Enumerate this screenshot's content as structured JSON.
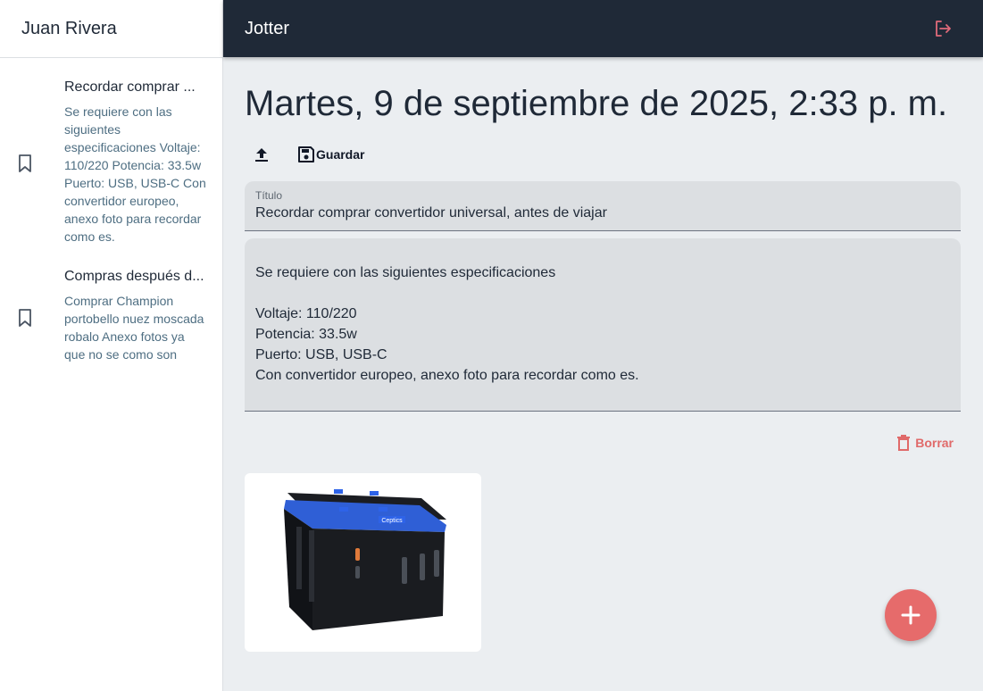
{
  "user": {
    "name": "Juan Rivera"
  },
  "app": {
    "title": "Jotter"
  },
  "notes": [
    {
      "title": "Recordar comprar ...",
      "preview": "Se requiere con las siguientes especificaciones Voltaje: 110/220 Potencia: 33.5w Puerto: USB, USB-C Con convertidor europeo, anexo foto para recordar como es."
    },
    {
      "title": "Compras después d...",
      "preview": "Comprar Champion portobello nuez moscada robalo Anexo fotos ya que no se como son"
    }
  ],
  "editor": {
    "date": "Martes, 9 de septiembre de 2025, 2:33 p. m.",
    "save_label": "Guardar",
    "title_label": "Título",
    "title_value": "Recordar comprar convertidor universal, antes de viajar",
    "body_lines": [
      "Se requiere con las siguientes especificaciones",
      "",
      "Voltaje: 110/220",
      "Potencia: 33.5w",
      "Puerto: USB, USB-C",
      "Con convertidor europeo, anexo foto para recordar como es."
    ],
    "delete_label": "Borrar",
    "image_brand": "Ceptics"
  },
  "icons": {
    "bookmark": "bookmark-icon",
    "logout": "logout-icon",
    "upload": "upload-icon",
    "save": "save-icon",
    "delete": "trash-icon",
    "add": "plus-icon"
  },
  "colors": {
    "topbar": "#1f2937",
    "accent_red": "#e66b6b",
    "sidebar_text": "#4e6e82"
  }
}
